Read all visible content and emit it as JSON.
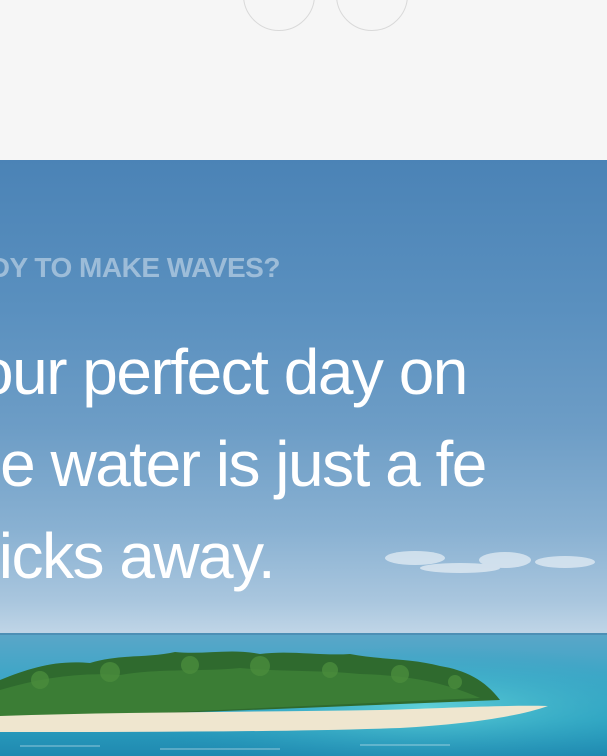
{
  "carousel": {
    "prev_icon": "chevron-left-icon",
    "next_icon": "chevron-right-icon"
  },
  "hero": {
    "eyebrow": "ADY TO MAKE WAVES?",
    "headline_lines": [
      "our perfect day on",
      "he water is just a fe",
      "licks away."
    ]
  },
  "colors": {
    "page_background": "#f6f6f6",
    "sky_top": "#4b83b6",
    "sea": "#2f9fbf",
    "text": "#ffffff"
  }
}
